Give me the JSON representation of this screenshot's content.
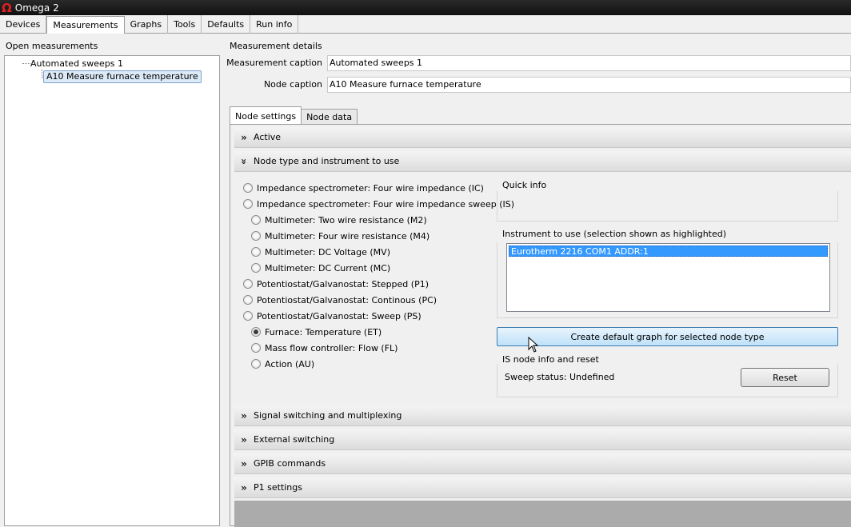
{
  "window": {
    "title": "Omega 2"
  },
  "menu_tabs": [
    {
      "label": "Devices"
    },
    {
      "label": "Measurements",
      "active": true
    },
    {
      "label": "Graphs"
    },
    {
      "label": "Tools"
    },
    {
      "label": "Defaults"
    },
    {
      "label": "Run info"
    }
  ],
  "left": {
    "label": "Open measurements",
    "tree_root": "Automated sweeps 1",
    "tree_child": "A10 Measure furnace temperature"
  },
  "details": {
    "label": "Measurement details",
    "measurement_caption_label": "Measurement caption",
    "measurement_caption_value": "Automated sweeps 1",
    "node_caption_label": "Node caption",
    "node_caption_value": "A10 Measure furnace temperature"
  },
  "sub_tabs": [
    {
      "label": "Node settings",
      "active": true
    },
    {
      "label": "Node data"
    }
  ],
  "sections": {
    "active": "Active",
    "node_type": "Node type and instrument to use",
    "signal": "Signal switching and multiplexing",
    "external": "External switching",
    "gpib": "GPIB commands",
    "p1": "P1 settings"
  },
  "node_types": [
    "Impedance spectrometer: Four wire impedance (IC)",
    "Impedance spectrometer: Four wire impedance sweep (IS)",
    "Multimeter: Two wire resistance (M2)",
    "Multimeter: Four wire resistance (M4)",
    "Multimeter: DC Voltage (MV)",
    "Multimeter: DC Current (MC)",
    "Potentiostat/Galvanostat: Stepped (P1)",
    "Potentiostat/Galvanostat: Continous (PC)",
    "Potentiostat/Galvanostat: Sweep (PS)",
    "Furnace: Temperature (ET)",
    "Mass flow controller: Flow (FL)",
    "Action (AU)"
  ],
  "selected_node_type": "Furnace: Temperature (ET)",
  "quick_info": {
    "label": "Quick info"
  },
  "instrument": {
    "label": "Instrument to use (selection shown as highlighted)",
    "items": [
      "Eurotherm 2216 COM1 ADDR:1"
    ]
  },
  "create_button": "Create default graph for selected node type",
  "is_info": {
    "label": "IS node info and reset",
    "status": "Sweep status: Undefined",
    "reset_button": "Reset"
  },
  "colors": {
    "selection": "#3399ff",
    "button_highlight": "#bfe1f8",
    "title_bar": "#101010",
    "omega_icon": "#e02020"
  }
}
